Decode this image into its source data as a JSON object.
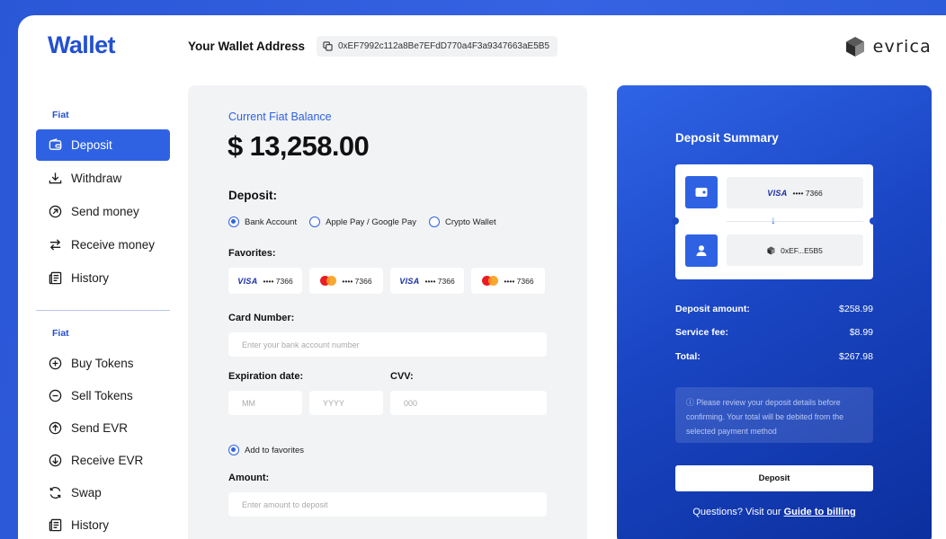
{
  "header": {
    "logo": "Wallet",
    "address_label": "Your Wallet Address",
    "address_value": "0xEF7992c112a8Be7EFdD770a4F3a9347663aE5B5",
    "brand_name": "evrica"
  },
  "sidebar": {
    "fiat_label": "Fiat",
    "fiat_items": [
      {
        "label": "Deposit",
        "icon": "wallet-icon",
        "active": true
      },
      {
        "label": "Withdraw",
        "icon": "download-icon"
      },
      {
        "label": "Send money",
        "icon": "arrow-up-right-circle-icon"
      },
      {
        "label": "Receive money",
        "icon": "swap-horizontal-icon"
      },
      {
        "label": "History",
        "icon": "document-icon"
      }
    ],
    "token_label": "Fiat",
    "token_items": [
      {
        "label": "Buy Tokens",
        "icon": "plus-circle-icon"
      },
      {
        "label": "Sell Tokens",
        "icon": "minus-circle-icon"
      },
      {
        "label": "Send EVR",
        "icon": "arrow-up-circle-icon"
      },
      {
        "label": "Receive EVR",
        "icon": "arrow-down-circle-icon"
      },
      {
        "label": "Swap",
        "icon": "refresh-icon"
      },
      {
        "label": "History",
        "icon": "document-icon"
      }
    ]
  },
  "balance": {
    "label": "Current Fiat Balance",
    "value": "$ 13,258.00"
  },
  "deposit_form": {
    "title": "Deposit:",
    "methods": [
      {
        "label": "Bank Account",
        "selected": true
      },
      {
        "label": "Apple Pay / Google Pay",
        "selected": false
      },
      {
        "label": "Crypto Wallet",
        "selected": false
      }
    ],
    "favorites_label": "Favorites:",
    "favorites": [
      {
        "brand": "VISA",
        "digits": "•••• 7366"
      },
      {
        "brand": "mastercard",
        "digits": "•••• 7366"
      },
      {
        "brand": "VISA",
        "digits": "•••• 7366"
      },
      {
        "brand": "mastercard",
        "digits": "•••• 7366"
      }
    ],
    "card_number_label": "Card Number:",
    "card_number_placeholder": "Enter your bank account number",
    "expiration_label": "Expiration date:",
    "mm_placeholder": "MM",
    "yyyy_placeholder": "YYYY",
    "cvv_label": "CVV:",
    "cvv_placeholder": "000",
    "add_favorites_label": "Add to favorites",
    "amount_label": "Amount:",
    "amount_placeholder": "Enter amount to deposit"
  },
  "summary": {
    "title": "Deposit Summary",
    "from_brand": "VISA",
    "from_digits": "•••• 7366",
    "to_address": "0xEF...E5B5",
    "rows": [
      {
        "label": "Deposit amount:",
        "value": "$258.99"
      },
      {
        "label": "Service fee:",
        "value": "$8.99"
      },
      {
        "label": "Total:",
        "value": "$267.98"
      }
    ],
    "note": "Please review your deposit details before confirming. Your total will be debited from the selected payment method",
    "button_label": "Deposit",
    "help_text": "Questions? Visit our",
    "help_link": "Guide to billing"
  },
  "colors": {
    "accent": "#2f62e3",
    "logo": "#2350d0",
    "panel_bg": "#f2f3f5"
  }
}
